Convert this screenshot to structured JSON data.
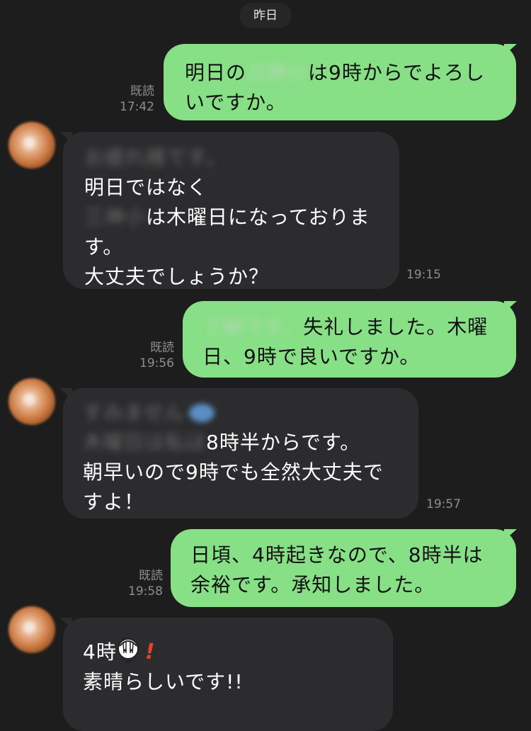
{
  "date_label": "昨日",
  "colors": {
    "background": "#1d1d1d",
    "incoming_bubble": "#2c2c2e",
    "outgoing_bubble": "#87df86"
  },
  "messages": [
    {
      "sender": "self",
      "read": "既読",
      "time": "17:42",
      "lines": [
        "明日の",
        "は9時からでよろし",
        "いですか。"
      ],
      "blurred": "三神小"
    },
    {
      "sender": "other",
      "time": "19:15",
      "lines": [
        "お疲れ様です。",
        "明日ではなく",
        "三神小",
        "は木曜日になっておりま",
        "す。",
        "大丈夫でしょうか？"
      ]
    },
    {
      "sender": "self",
      "read": "既読",
      "time": "19:56",
      "lines": [
        "了解です。",
        "失礼しました。木曜",
        "日、9時で良いですか。"
      ]
    },
    {
      "sender": "other",
      "time": "19:57",
      "lines": [
        "すみません",
        "木曜日は私は",
        "8時半からです。",
        "朝早いので9時でも全然大丈夫で",
        "すよ！"
      ]
    },
    {
      "sender": "self",
      "read": "既読",
      "time": "19:58",
      "lines": [
        "日頃、4時起きなので、8時半は",
        "余裕です。承知しました。"
      ]
    },
    {
      "sender": "other",
      "lines": [
        "4時",
        "!",
        "素晴らしいです!!"
      ]
    }
  ]
}
